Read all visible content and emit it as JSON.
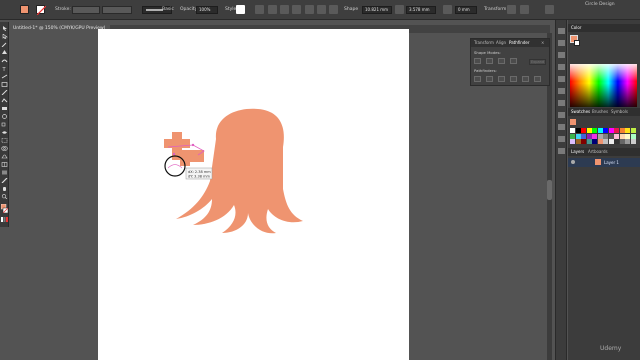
{
  "control_bar": {
    "stroke_label": "Stroke:",
    "stroke_value": "",
    "basic_label": "Basic",
    "opacity_label": "Opacity:",
    "opacity_value": "100%",
    "style_label": "Style:",
    "shape_label": "Shape",
    "width_value": "10.821 mm",
    "height_value": "3.578 mm",
    "zero_value": "0 mm",
    "transform_label": "Transform",
    "workspace_label": "Circle Design"
  },
  "document_tab": {
    "title": "Untitled-1* @ 150% (CMYK/GPU Preview)"
  },
  "pathfinder_panel": {
    "tabs": [
      "Transform",
      "Align",
      "Pathfinder"
    ],
    "active_tab": "Pathfinder",
    "shape_modes_label": "Shape Modes:",
    "pathfinders_label": "Pathfinders:",
    "expand_label": "Expand"
  },
  "color_panel": {
    "title": "Color"
  },
  "swatches_panel": {
    "tabs": [
      "Swatches",
      "Brushes",
      "Symbols"
    ]
  },
  "layers_panel": {
    "tabs": [
      "Layers",
      "Artboards"
    ],
    "layer_name": "Layer 1"
  },
  "tooltip": {
    "line1": "dX: 2.38 mm",
    "line2": "dY: 3.38 mm"
  },
  "watermark": "Udemy",
  "colors": {
    "octopus": "#ef9470",
    "selection": "#e060c0",
    "artboard": "#ffffff"
  }
}
